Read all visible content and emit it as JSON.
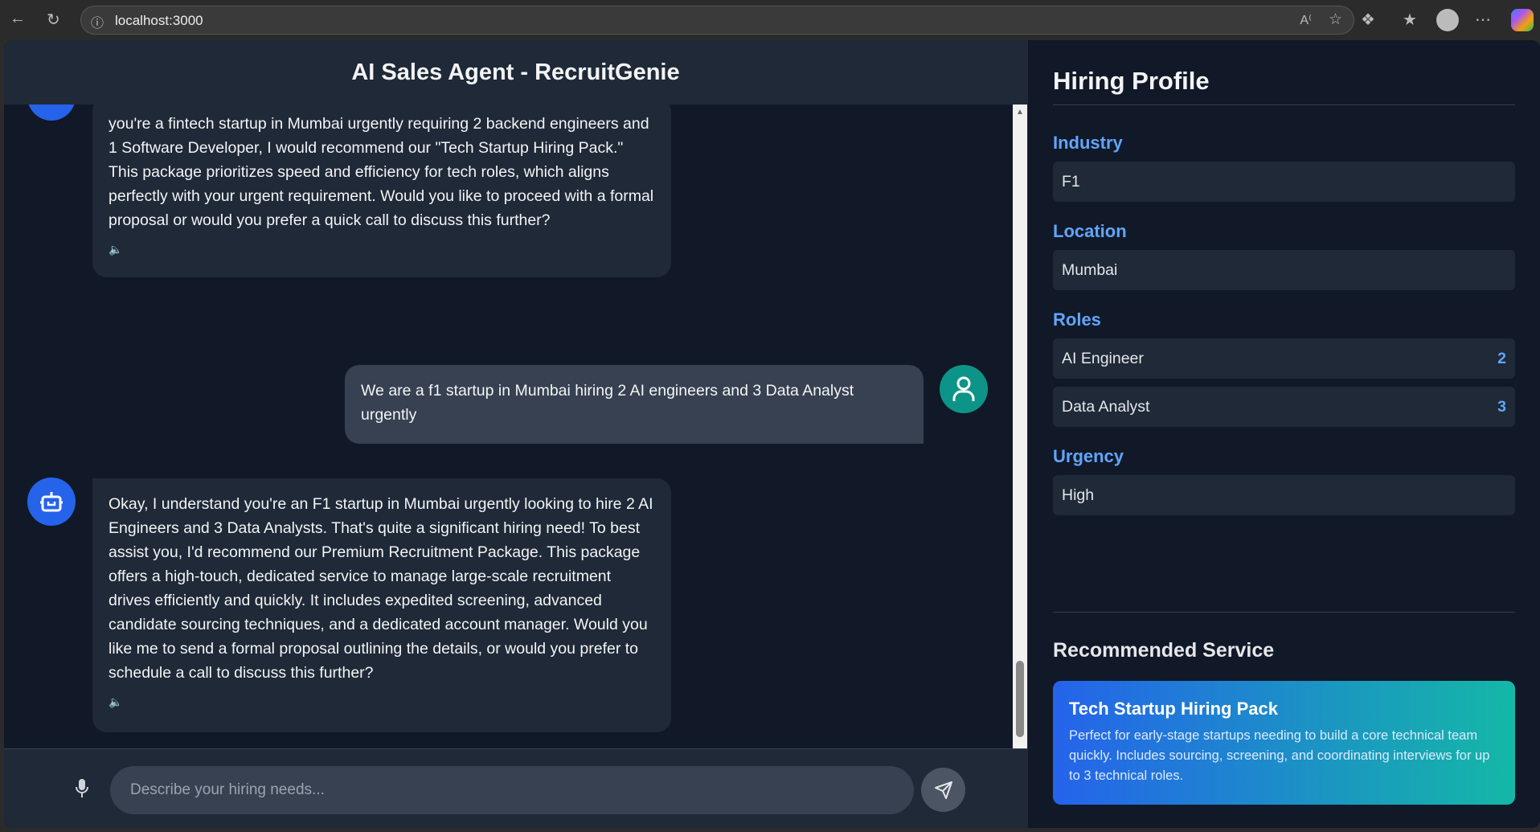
{
  "browser": {
    "url": "localhost:3000"
  },
  "chat": {
    "title": "AI Sales Agent - RecruitGenie",
    "messages": [
      {
        "role": "bot",
        "text": "you're a fintech startup in Mumbai urgently requiring 2 backend engineers and 1 Software Developer, I would recommend our \"Tech Startup Hiring Pack.\" This package prioritizes speed and efficiency for tech roles, which aligns perfectly with your urgent requirement. Would you like to proceed with a formal proposal or would you prefer a quick call to discuss this further?"
      },
      {
        "role": "user",
        "text": "We are a f1 startup in Mumbai hiring 2 AI engineers and 3 Data Analyst urgently"
      },
      {
        "role": "bot",
        "text": "Okay, I understand you're an F1 startup in Mumbai urgently looking to hire 2 AI Engineers and 3 Data Analysts. That's quite a significant hiring need! To best assist you, I'd recommend our Premium Recruitment Package.  This package offers a high-touch, dedicated service to manage large-scale recruitment drives efficiently and quickly. It includes expedited screening, advanced candidate sourcing techniques, and a dedicated account manager. Would you like me to send a formal proposal outlining the details, or would you prefer to schedule a call to discuss this further?"
      }
    ],
    "input_placeholder": "Describe your hiring needs..."
  },
  "profile": {
    "title": "Hiring Profile",
    "industry_label": "Industry",
    "industry": "F1",
    "location_label": "Location",
    "location": "Mumbai",
    "roles_label": "Roles",
    "roles": [
      {
        "name": "AI Engineer",
        "count": "2"
      },
      {
        "name": "Data Analyst",
        "count": "3"
      }
    ],
    "urgency_label": "Urgency",
    "urgency": "High"
  },
  "recommended": {
    "heading": "Recommended Service",
    "name": "Tech Startup Hiring Pack",
    "description": "Perfect for early-stage startups needing to build a core technical team quickly. Includes sourcing, screening, and coordinating interviews for up to 3 technical roles."
  }
}
